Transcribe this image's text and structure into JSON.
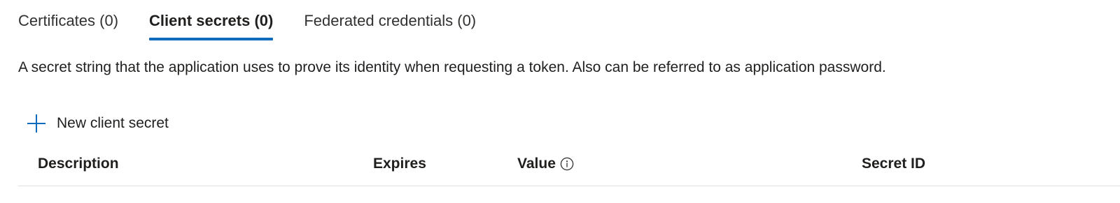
{
  "tabs": [
    {
      "label": "Certificates (0)",
      "active": false
    },
    {
      "label": "Client secrets (0)",
      "active": true
    },
    {
      "label": "Federated credentials (0)",
      "active": false
    }
  ],
  "description": "A secret string that the application uses to prove its identity when requesting a token. Also can be referred to as application password.",
  "toolbar": {
    "new_secret_label": "New client secret",
    "new_secret_icon": "plus-icon"
  },
  "table": {
    "columns": [
      "Description",
      "Expires",
      "Value",
      "Secret ID"
    ],
    "value_info_icon": "info-icon",
    "rows": []
  },
  "colors": {
    "accent": "#0f6cbd",
    "text": "#201f1e",
    "divider": "#e1dfdd"
  }
}
